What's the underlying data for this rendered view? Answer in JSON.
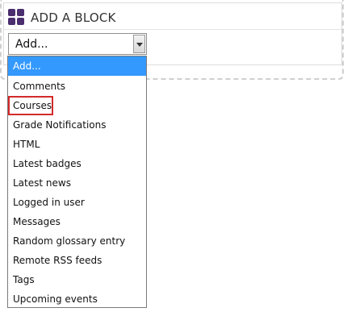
{
  "block": {
    "title": "ADD A BLOCK",
    "icon": "blocks-grid-icon",
    "icon_color": "#4b2e6e"
  },
  "select": {
    "value": "Add..."
  },
  "dropdown": {
    "selected_color": "#3399ff",
    "highlight_color": "#d42a2a",
    "options": [
      "Add...",
      "Comments",
      "Courses",
      "Grade Notifications",
      "HTML",
      "Latest badges",
      "Latest news",
      "Logged in user",
      "Messages",
      "Random glossary entry",
      "Remote RSS feeds",
      "Tags",
      "Upcoming events"
    ]
  }
}
